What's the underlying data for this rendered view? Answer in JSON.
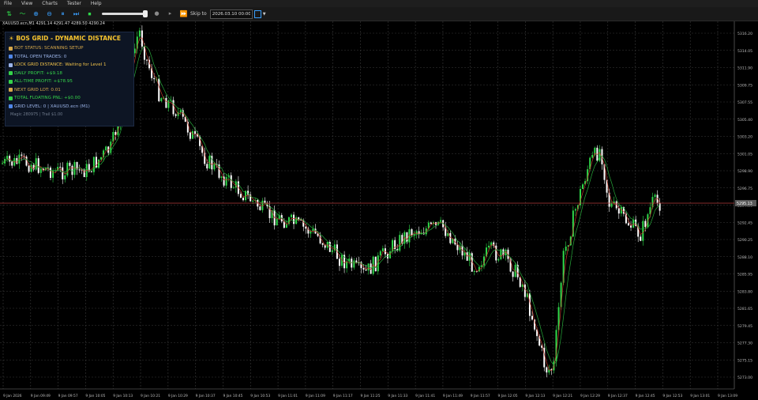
{
  "menu": [
    "File",
    "View",
    "Charts",
    "Tester",
    "Help"
  ],
  "toolbar": {
    "skip_to_label": "Skip to",
    "skip_to_value": "2026.03.10 00:00"
  },
  "symbol_line": "XAUUSD.ecn,M1  4291.14 4291.47 4289.50 4290.24",
  "panel": {
    "title": "BOS GRID - DYNAMIC DISTANCE",
    "rows": [
      {
        "text": "BOT STATUS: SCANNING SETUP",
        "color": "#d6a84a",
        "icon": "#d6a84a"
      },
      {
        "text": "TOTAL OPEN TRADES: 0",
        "color": "#9bb4e8",
        "icon": "#4f86e8"
      },
      {
        "text": "LOCK GRID DISTANCE: Waiting for Level 1",
        "color": "#f0c24a",
        "icon": "#9bb4e8"
      },
      {
        "text": "DAILY PROFIT: +$9.18",
        "color": "#35d24a",
        "icon": "#35d24a"
      },
      {
        "text": "ALL-TIME PROFIT: +$78.95",
        "color": "#35d24a",
        "icon": "#35d24a"
      },
      {
        "text": "NEXT GRID LOT: 0.01",
        "color": "#d6a84a",
        "icon": "#d6a84a"
      },
      {
        "text": "TOTAL FLOATING PNL: +$0.00",
        "color": "#35d24a",
        "icon": "#35d24a"
      },
      {
        "text": "GRID LEVEL: 0 | XAUUSD.ecn (M1)",
        "color": "#9bb4e8",
        "icon": "#4f86e8"
      }
    ],
    "footer": "Magic 280975 | Trail $1.00"
  },
  "chart_data": {
    "type": "candlestick",
    "symbol": "XAUUSD.ecn",
    "timeframe": "M1",
    "y_axis_ticks": [
      "5316.20",
      "5314.05",
      "5311.90",
      "5309.75",
      "5307.55",
      "5305.40",
      "5303.20",
      "5301.05",
      "5298.90",
      "5296.75",
      "5294.60",
      "5292.45",
      "5290.25",
      "5288.10",
      "5285.95",
      "5283.80",
      "5281.65",
      "5279.45",
      "5277.30",
      "5275.15",
      "5273.00"
    ],
    "current_price": "5295.13",
    "x_axis_ticks": [
      "9 Jan 2026",
      "9 Jan 09:49",
      "9 Jan 09:57",
      "9 Jan 10:05",
      "9 Jan 10:13",
      "9 Jan 10:21",
      "9 Jan 10:29",
      "9 Jan 10:37",
      "9 Jan 10:45",
      "9 Jan 10:53",
      "9 Jan 11:01",
      "9 Jan 11:09",
      "9 Jan 11:17",
      "9 Jan 11:25",
      "9 Jan 11:33",
      "9 Jan 11:41",
      "9 Jan 11:49",
      "9 Jan 11:57",
      "9 Jan 12:05",
      "9 Jan 12:13",
      "9 Jan 12:21",
      "9 Jan 12:29",
      "9 Jan 12:37",
      "9 Jan 12:45",
      "9 Jan 12:53",
      "9 Jan 13:01",
      "9 Jan 13:09"
    ],
    "colors": {
      "bull": "#2fd94a",
      "bear": "#ffffff",
      "grid": "#3a3a3a",
      "price_line": "#b33a3a",
      "ma_fast": "#c0392b",
      "ma_slow": "#27a83a",
      "axis_text": "#bdbdbd",
      "price_label_bg": "#5a5a5a"
    }
  }
}
